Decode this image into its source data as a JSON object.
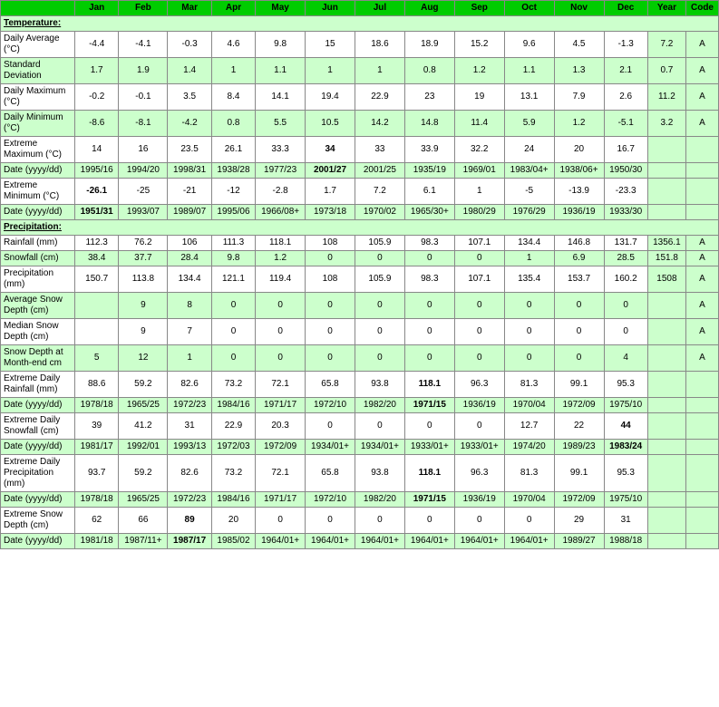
{
  "table": {
    "headers": [
      "",
      "Jan",
      "Feb",
      "Mar",
      "Apr",
      "May",
      "Jun",
      "Jul",
      "Aug",
      "Sep",
      "Oct",
      "Nov",
      "Dec",
      "Year",
      "Code"
    ],
    "sections": [
      {
        "label": "Temperature:",
        "rows": [
          {
            "label": "Daily Average (°C)",
            "values": [
              "-4.4",
              "-4.1",
              "-0.3",
              "4.6",
              "9.8",
              "15",
              "18.6",
              "18.9",
              "15.2",
              "9.6",
              "4.5",
              "-1.3",
              "7.2",
              "A"
            ],
            "style": "white"
          },
          {
            "label": "Standard Deviation",
            "values": [
              "1.7",
              "1.9",
              "1.4",
              "1",
              "1.1",
              "1",
              "1",
              "0.8",
              "1.2",
              "1.1",
              "1.3",
              "2.1",
              "0.7",
              "A"
            ],
            "style": "green"
          },
          {
            "label": "Daily Maximum (°C)",
            "values": [
              "-0.2",
              "-0.1",
              "3.5",
              "8.4",
              "14.1",
              "19.4",
              "22.9",
              "23",
              "19",
              "13.1",
              "7.9",
              "2.6",
              "11.2",
              "A"
            ],
            "style": "white"
          },
          {
            "label": "Daily Minimum (°C)",
            "values": [
              "-8.6",
              "-8.1",
              "-4.2",
              "0.8",
              "5.5",
              "10.5",
              "14.2",
              "14.8",
              "11.4",
              "5.9",
              "1.2",
              "-5.1",
              "3.2",
              "A"
            ],
            "style": "green"
          },
          {
            "label": "Extreme Maximum (°C)",
            "values": [
              "14",
              "16",
              "23.5",
              "26.1",
              "33.3",
              "34",
              "33",
              "33.9",
              "32.2",
              "24",
              "20",
              "16.7",
              "",
              ""
            ],
            "style": "white",
            "bold_indices": [
              5
            ]
          },
          {
            "label": "Date (yyyy/dd)",
            "values": [
              "1995/16",
              "1994/20",
              "1998/31",
              "1938/28",
              "1977/23",
              "2001/27",
              "2001/25",
              "1935/19",
              "1969/01",
              "1983/04+",
              "1938/06+",
              "1950/30",
              "",
              ""
            ],
            "style": "green",
            "bold_indices": [
              5
            ]
          },
          {
            "label": "Extreme Minimum (°C)",
            "values": [
              "-26.1",
              "-25",
              "-21",
              "-12",
              "-2.8",
              "1.7",
              "7.2",
              "6.1",
              "1",
              "-5",
              "-13.9",
              "-23.3",
              "",
              ""
            ],
            "style": "white",
            "bold_indices": [
              0
            ]
          },
          {
            "label": "Date (yyyy/dd)",
            "values": [
              "1951/31",
              "1993/07",
              "1989/07",
              "1995/06",
              "1966/08+",
              "1973/18",
              "1970/02",
              "1965/30+",
              "1980/29",
              "1976/29",
              "1936/19",
              "1933/30",
              "",
              ""
            ],
            "style": "green",
            "bold_indices": [
              0
            ]
          }
        ]
      },
      {
        "label": "Precipitation:",
        "rows": [
          {
            "label": "Rainfall (mm)",
            "values": [
              "112.3",
              "76.2",
              "106",
              "111.3",
              "118.1",
              "108",
              "105.9",
              "98.3",
              "107.1",
              "134.4",
              "146.8",
              "131.7",
              "1356.1",
              "A"
            ],
            "style": "white"
          },
          {
            "label": "Snowfall (cm)",
            "values": [
              "38.4",
              "37.7",
              "28.4",
              "9.8",
              "1.2",
              "0",
              "0",
              "0",
              "0",
              "1",
              "6.9",
              "28.5",
              "151.8",
              "A"
            ],
            "style": "green"
          },
          {
            "label": "Precipitation (mm)",
            "values": [
              "150.7",
              "113.8",
              "134.4",
              "121.1",
              "119.4",
              "108",
              "105.9",
              "98.3",
              "107.1",
              "135.4",
              "153.7",
              "160.2",
              "1508",
              "A"
            ],
            "style": "white"
          },
          {
            "label": "Average Snow Depth (cm)",
            "values": [
              "",
              "9",
              "8",
              "0",
              "0",
              "0",
              "0",
              "0",
              "0",
              "0",
              "0",
              "0",
              "",
              "A"
            ],
            "style": "green"
          },
          {
            "label": "Median Snow Depth (cm)",
            "values": [
              "",
              "9",
              "7",
              "0",
              "0",
              "0",
              "0",
              "0",
              "0",
              "0",
              "0",
              "0",
              "",
              "A"
            ],
            "style": "white"
          },
          {
            "label": "Snow Depth at Month-end cm",
            "values": [
              "5",
              "12",
              "1",
              "0",
              "0",
              "0",
              "0",
              "0",
              "0",
              "0",
              "0",
              "4",
              "",
              "A"
            ],
            "style": "green"
          },
          {
            "label": "Extreme Daily Rainfall (mm)",
            "values": [
              "88.6",
              "59.2",
              "82.6",
              "73.2",
              "72.1",
              "65.8",
              "93.8",
              "118.1",
              "96.3",
              "81.3",
              "99.1",
              "95.3",
              "",
              ""
            ],
            "style": "white",
            "bold_indices": [
              7
            ]
          },
          {
            "label": "Date (yyyy/dd)",
            "values": [
              "1978/18",
              "1965/25",
              "1972/23",
              "1984/16",
              "1971/17",
              "1972/10",
              "1982/20",
              "1971/15",
              "1936/19",
              "1970/04",
              "1972/09",
              "1975/10",
              "",
              ""
            ],
            "style": "green",
            "bold_indices": [
              7
            ]
          },
          {
            "label": "Extreme Daily Snowfall (cm)",
            "values": [
              "39",
              "41.2",
              "31",
              "22.9",
              "20.3",
              "0",
              "0",
              "0",
              "0",
              "12.7",
              "22",
              "44",
              "",
              ""
            ],
            "style": "white",
            "bold_indices": [
              11
            ]
          },
          {
            "label": "Date (yyyy/dd)",
            "values": [
              "1981/17",
              "1992/01",
              "1993/13",
              "1972/03",
              "1972/09",
              "1934/01+",
              "1934/01+",
              "1933/01+",
              "1933/01+",
              "1974/20",
              "1989/23",
              "1983/24",
              "",
              ""
            ],
            "style": "green",
            "bold_indices": [
              11
            ]
          },
          {
            "label": "Extreme Daily Precipitation (mm)",
            "values": [
              "93.7",
              "59.2",
              "82.6",
              "73.2",
              "72.1",
              "65.8",
              "93.8",
              "118.1",
              "96.3",
              "81.3",
              "99.1",
              "95.3",
              "",
              ""
            ],
            "style": "white",
            "bold_indices": [
              7
            ]
          },
          {
            "label": "Date (yyyy/dd)",
            "values": [
              "1978/18",
              "1965/25",
              "1972/23",
              "1984/16",
              "1971/17",
              "1972/10",
              "1982/20",
              "1971/15",
              "1936/19",
              "1970/04",
              "1972/09",
              "1975/10",
              "",
              ""
            ],
            "style": "green",
            "bold_indices": [
              7
            ]
          },
          {
            "label": "Extreme Snow Depth (cm)",
            "values": [
              "62",
              "66",
              "89",
              "20",
              "0",
              "0",
              "0",
              "0",
              "0",
              "0",
              "29",
              "31",
              "",
              ""
            ],
            "style": "white",
            "bold_indices": [
              2
            ]
          },
          {
            "label": "Date (yyyy/dd)",
            "values": [
              "1981/18",
              "1987/11+",
              "1987/17",
              "1985/02",
              "1964/01+",
              "1964/01+",
              "1964/01+",
              "1964/01+",
              "1964/01+",
              "1964/01+",
              "1989/27",
              "1988/18",
              "",
              ""
            ],
            "style": "green",
            "bold_indices": [
              2
            ]
          }
        ]
      }
    ]
  }
}
